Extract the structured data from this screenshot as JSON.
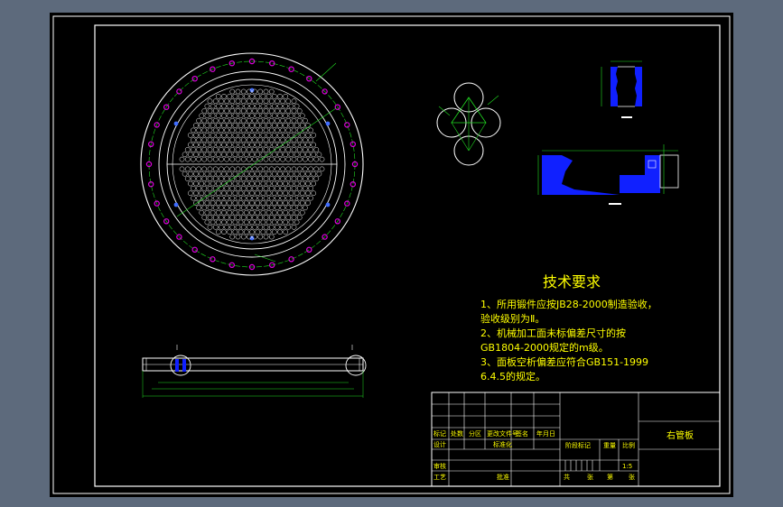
{
  "requirements": {
    "title": "技术要求",
    "lines": [
      "1、所用锻件应按JB28-2000制造验收，",
      "验收级别为Ⅱ。",
      "2、机械加工面未标偏差尺寸的按",
      "GB1804-2000规定的m级。",
      "3、面板空析偏差应符合GB151-1999",
      "6.4.5的规定。"
    ]
  },
  "title_block": {
    "drawing_name": "右管板",
    "row_labels": [
      "标记",
      "处数",
      "分区",
      "更改文件号",
      "签名",
      "年月日"
    ],
    "designer_label": "设计",
    "standardize_label": "标准化",
    "stage_label": "阶段标记",
    "weight_label": "重量",
    "scale_label": "比例",
    "review_label": "审核",
    "craft_label": "工艺",
    "approve_label": "批准",
    "scale_value": "1:5",
    "sheets_total": "共",
    "sheets_unit": "张",
    "sheet_no": "第",
    "sheet_unit": "张"
  },
  "colors": {
    "screen_bg": "#5d6a7c",
    "paper_bg": "#000000",
    "line_white": "#ffffff",
    "annotation_green": "#22dd22",
    "hole_magenta": "#e000e0",
    "hole_blue": "#3f6cff",
    "hatch_blue": "#1020ff",
    "text_yellow": "#ffff00"
  }
}
